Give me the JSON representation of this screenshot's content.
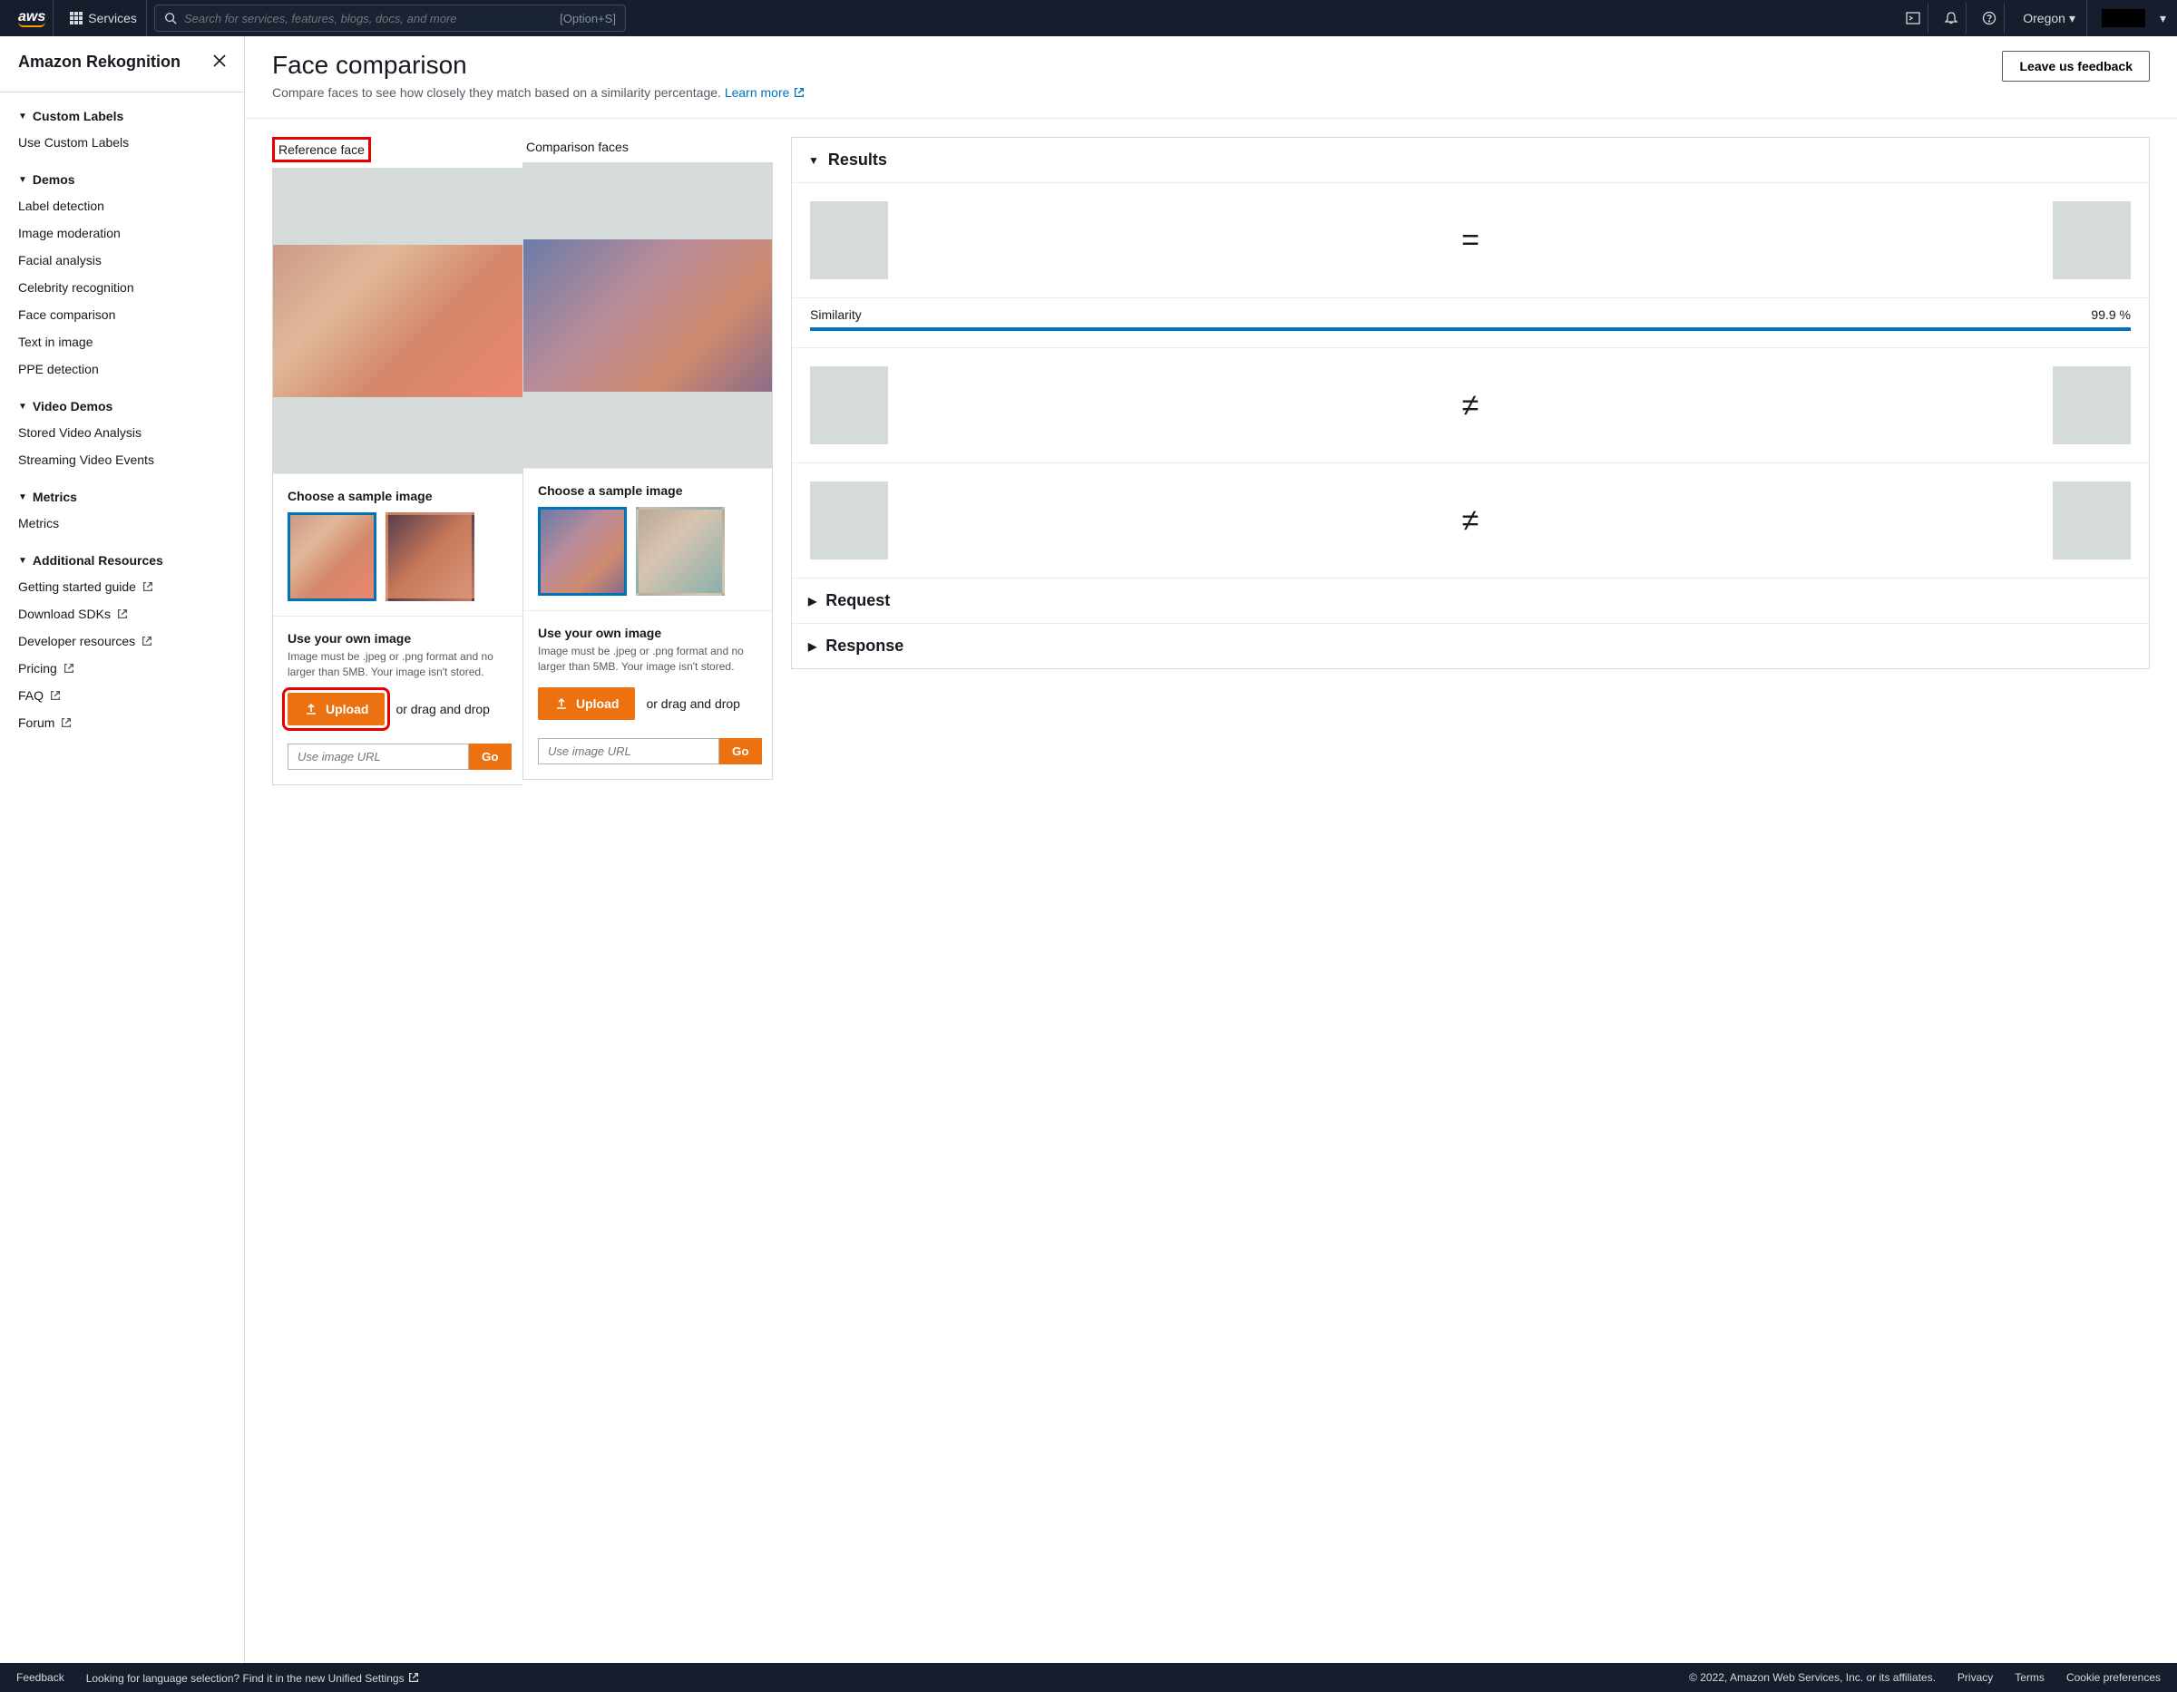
{
  "topnav": {
    "services_label": "Services",
    "search_placeholder": "Search for services, features, blogs, docs, and more",
    "search_shortcut": "[Option+S]",
    "region": "Oregon"
  },
  "sidebar": {
    "title": "Amazon Rekognition",
    "sections": [
      {
        "heading": "Custom Labels",
        "items": [
          "Use Custom Labels"
        ]
      },
      {
        "heading": "Demos",
        "items": [
          "Label detection",
          "Image moderation",
          "Facial analysis",
          "Celebrity recognition",
          "Face comparison",
          "Text in image",
          "PPE detection"
        ]
      },
      {
        "heading": "Video Demos",
        "items": [
          "Stored Video Analysis",
          "Streaming Video Events"
        ]
      },
      {
        "heading": "Metrics",
        "items": [
          "Metrics"
        ]
      },
      {
        "heading": "Additional Resources",
        "items": [
          "Getting started guide",
          "Download SDKs",
          "Developer resources",
          "Pricing",
          "FAQ",
          "Forum"
        ],
        "external": true
      }
    ]
  },
  "page": {
    "title": "Face comparison",
    "description": "Compare faces to see how closely they match based on a similarity percentage.",
    "learn_more": "Learn more",
    "feedback_button": "Leave us feedback"
  },
  "reference": {
    "label": "Reference face",
    "sample_heading": "Choose a sample image",
    "own_heading": "Use your own image",
    "own_hint": "Image must be .jpeg or .png format and no larger than 5MB. Your image isn't stored.",
    "upload_label": "Upload",
    "drag_label": "or drag and drop",
    "url_placeholder": "Use image URL",
    "go_label": "Go"
  },
  "comparison": {
    "label": "Comparison faces",
    "sample_heading": "Choose a sample image",
    "own_heading": "Use your own image",
    "own_hint": "Image must be .jpeg or .png format and no larger than 5MB. Your image isn't stored.",
    "upload_label": "Upload",
    "drag_label": "or drag and drop",
    "url_placeholder": "Use image URL",
    "go_label": "Go"
  },
  "results": {
    "heading": "Results",
    "similarity_label": "Similarity",
    "similarity_value": "99.9 %",
    "items": [
      {
        "op": "="
      },
      {
        "op": "≠"
      },
      {
        "op": "≠"
      }
    ],
    "request_heading": "Request",
    "response_heading": "Response"
  },
  "footer": {
    "feedback": "Feedback",
    "lang_prompt": "Looking for language selection? Find it in the new",
    "unified": "Unified Settings",
    "copyright": "© 2022, Amazon Web Services, Inc. or its affiliates.",
    "privacy": "Privacy",
    "terms": "Terms",
    "cookie": "Cookie preferences"
  }
}
